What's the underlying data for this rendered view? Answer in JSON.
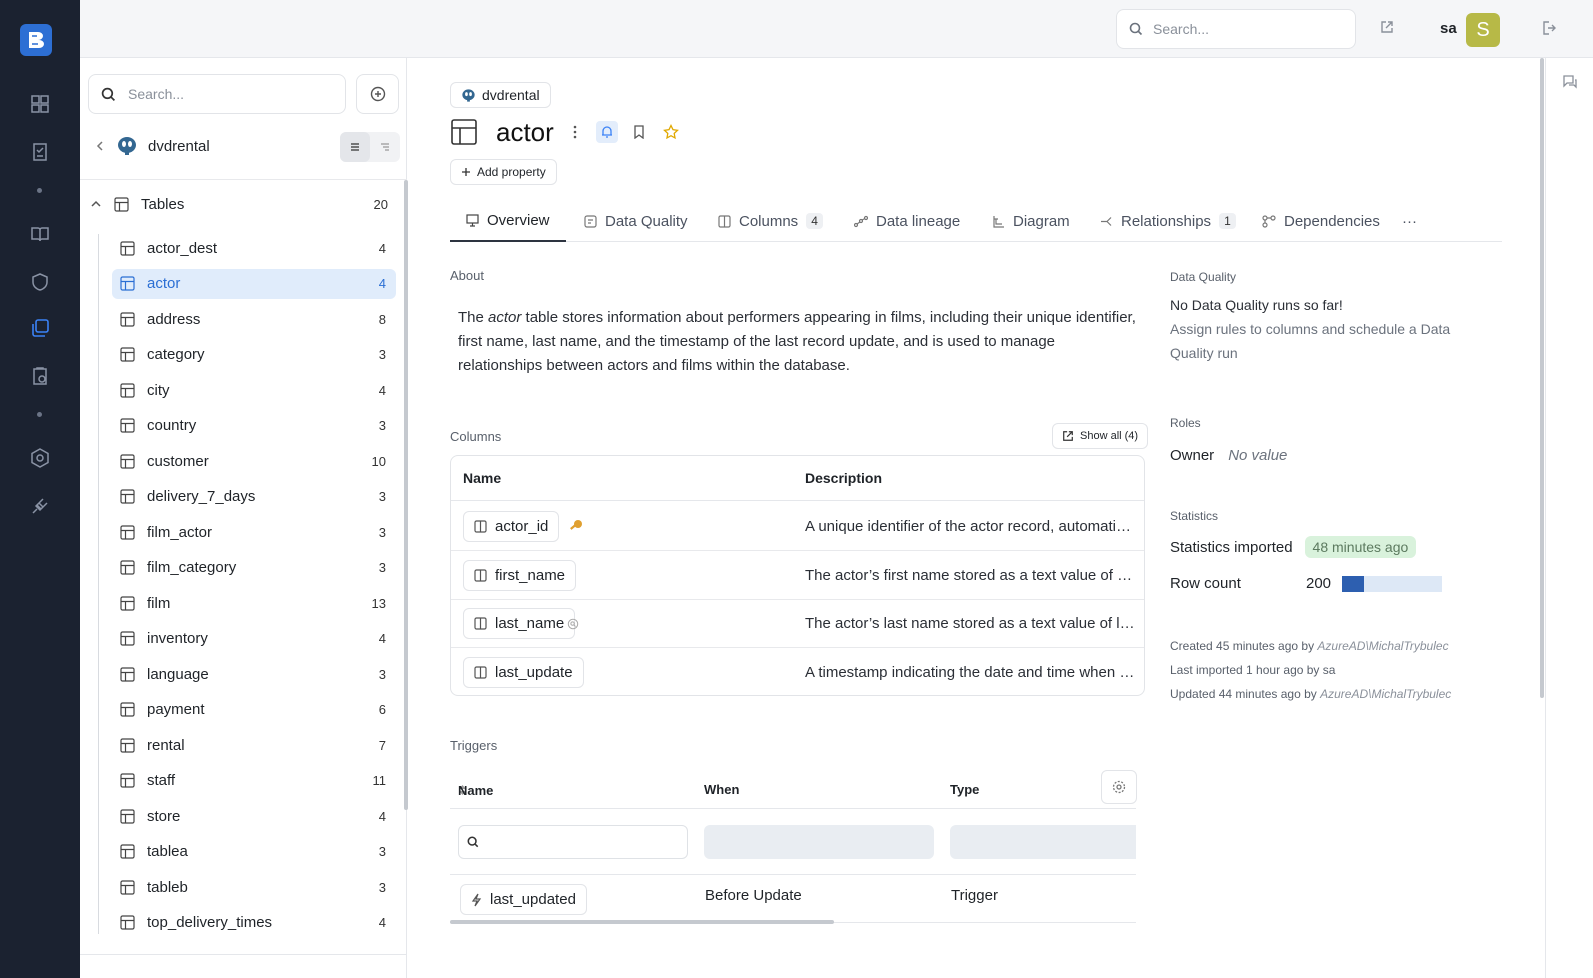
{
  "topbar": {
    "search_placeholder": "Search...",
    "username": "sa",
    "avatar_initial": "S"
  },
  "sidebar": {
    "search_placeholder": "Search...",
    "database": "dvdrental",
    "tables_label": "Tables",
    "tables_count": "20",
    "items": [
      {
        "name": "actor_dest",
        "count": "4"
      },
      {
        "name": "actor",
        "count": "4"
      },
      {
        "name": "address",
        "count": "8"
      },
      {
        "name": "category",
        "count": "3"
      },
      {
        "name": "city",
        "count": "4"
      },
      {
        "name": "country",
        "count": "3"
      },
      {
        "name": "customer",
        "count": "10"
      },
      {
        "name": "delivery_7_days",
        "count": "3"
      },
      {
        "name": "film_actor",
        "count": "3"
      },
      {
        "name": "film_category",
        "count": "3"
      },
      {
        "name": "film",
        "count": "13"
      },
      {
        "name": "inventory",
        "count": "4"
      },
      {
        "name": "language",
        "count": "3"
      },
      {
        "name": "payment",
        "count": "6"
      },
      {
        "name": "rental",
        "count": "7"
      },
      {
        "name": "staff",
        "count": "11"
      },
      {
        "name": "store",
        "count": "4"
      },
      {
        "name": "tablea",
        "count": "3"
      },
      {
        "name": "tableb",
        "count": "3"
      },
      {
        "name": "top_delivery_times",
        "count": "4"
      }
    ]
  },
  "main": {
    "breadcrumb": "dvdrental",
    "title": "actor",
    "add_property": "Add property",
    "tabs": [
      {
        "label": "Overview"
      },
      {
        "label": "Data Quality"
      },
      {
        "label": "Columns",
        "badge": "4"
      },
      {
        "label": "Data lineage"
      },
      {
        "label": "Diagram"
      },
      {
        "label": "Relationships",
        "badge": "1"
      },
      {
        "label": "Dependencies"
      },
      {
        "label": "···"
      }
    ],
    "about_label": "About",
    "about_pre": "The ",
    "about_em": "actor",
    "about_post": " table stores information about performers appearing in films, including their unique identifier, first name, last name, and the timestamp of the last record update, and is used to manage relationships between actors and films within the database.",
    "columns_label": "Columns",
    "show_all": "Show all (4)",
    "col_headers": {
      "name": "Name",
      "description": "Description"
    },
    "columns": [
      {
        "name": "actor_id",
        "desc": "A unique identifier of the actor record, automatically generated"
      },
      {
        "name": "first_name",
        "desc": "The actor’s first name stored as a text value of limited length"
      },
      {
        "name": "last_name",
        "desc": "The actor’s last name stored as a text value of limited length"
      },
      {
        "name": "last_update",
        "desc": "A timestamp indicating the date and time when the record was last updated"
      }
    ],
    "triggers_label": "Triggers",
    "trig_headers": {
      "name": "Name",
      "when": "When",
      "type": "Type"
    },
    "triggers": [
      {
        "name": "last_updated",
        "when": "Before Update",
        "type": "Trigger"
      }
    ]
  },
  "right": {
    "dq_label": "Data Quality",
    "dq_title": "No Data Quality runs so far!",
    "dq_sub": "Assign rules to columns and schedule a Data Quality run",
    "roles_label": "Roles",
    "owner_label": "Owner",
    "owner_value": "No value",
    "stats_label": "Statistics",
    "stats_imported_label": "Statistics imported",
    "stats_imported_value": "48 minutes ago",
    "rowcount_label": "Row count",
    "rowcount_value": "200",
    "rowcount_fill_fraction": 0.22,
    "created_pre": "Created 45 minutes ago by ",
    "created_by": "AzureAD\\MichalTrybulec",
    "imported": "Last imported 1 hour ago by sa",
    "updated_pre": "Updated 44 minutes ago by ",
    "updated_by": "AzureAD\\MichalTrybulec"
  },
  "colors": {
    "accent": "#2b6fd4",
    "rail": "#1b2230",
    "avatar": "#b7b947",
    "bar_fill": "#2d5fb0"
  }
}
